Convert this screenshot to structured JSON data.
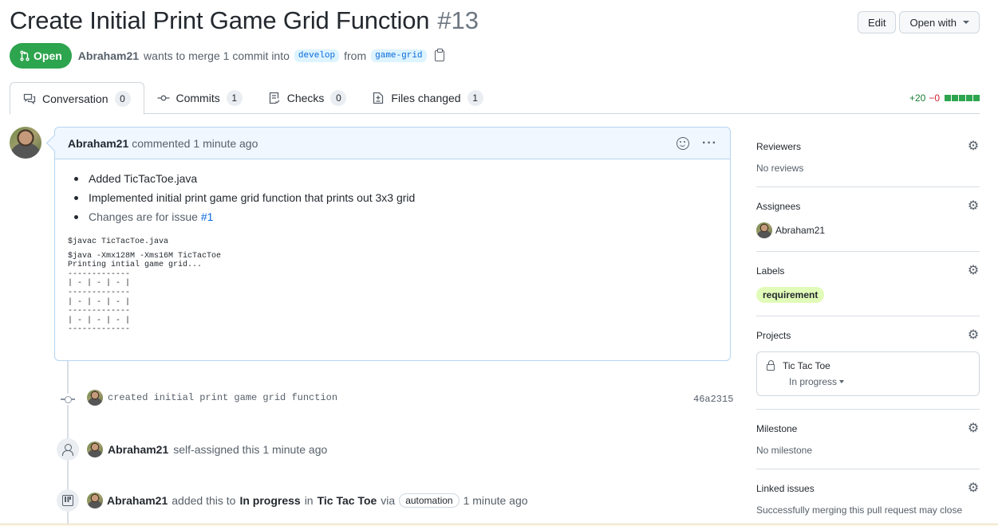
{
  "header": {
    "title": "Create Initial Print Game Grid Function",
    "number": "#13",
    "edit_label": "Edit",
    "open_with_label": "Open with"
  },
  "meta": {
    "state": "Open",
    "author": "Abraham21",
    "merge_text": "wants to merge 1 commit into",
    "base_branch": "develop",
    "from_text": "from",
    "head_branch": "game-grid"
  },
  "tabs": [
    {
      "label": "Conversation",
      "count": "0",
      "icon": "comment-discussion-icon",
      "active": true
    },
    {
      "label": "Commits",
      "count": "1",
      "icon": "git-commit-icon"
    },
    {
      "label": "Checks",
      "count": "0",
      "icon": "checklist-icon"
    },
    {
      "label": "Files changed",
      "count": "1",
      "icon": "file-diff-icon"
    }
  ],
  "diffstat": {
    "additions": "+20",
    "deletions": "−0",
    "colors": {
      "add": "#2da44e"
    }
  },
  "comment": {
    "author": "Abraham21",
    "action": "commented",
    "time": "1 minute ago",
    "bullets": [
      "Added TicTacToe.java",
      "Implemented initial print game grid function that prints out 3x3 grid"
    ],
    "issue_bullet_text": "Changes are for issue",
    "issue_link": "#1",
    "code_cmd1": "$javac TicTacToe.java",
    "code_output": "$java -Xmx128M -Xms16M TicTacToe\nPrinting intial game grid...\n-------------\n| - | - | - |\n-------------\n| - | - | - |\n-------------\n| - | - | - |\n-------------"
  },
  "timeline": {
    "commit_message": "created initial print game grid function",
    "commit_sha": "46a2315",
    "assign_author": "Abraham21",
    "assign_text": "self-assigned this 1 minute ago",
    "project_author": "Abraham21",
    "project_added": "added this to",
    "project_column": "In progress",
    "project_in": "in",
    "project_name": "Tic Tac Toe",
    "project_via": "via",
    "project_automation": "automation",
    "project_time": "1 minute ago"
  },
  "sidebar": {
    "reviewers": {
      "heading": "Reviewers",
      "value": "No reviews"
    },
    "assignees": {
      "heading": "Assignees",
      "value": "Abraham21"
    },
    "labels": {
      "heading": "Labels",
      "value": "requirement",
      "color": "#e1fbb8"
    },
    "projects": {
      "heading": "Projects",
      "name": "Tic Tac Toe",
      "column": "In progress"
    },
    "milestone": {
      "heading": "Milestone",
      "value": "No milestone"
    },
    "linked_issues": {
      "heading": "Linked issues",
      "value": "Successfully merging this pull request may close"
    }
  }
}
